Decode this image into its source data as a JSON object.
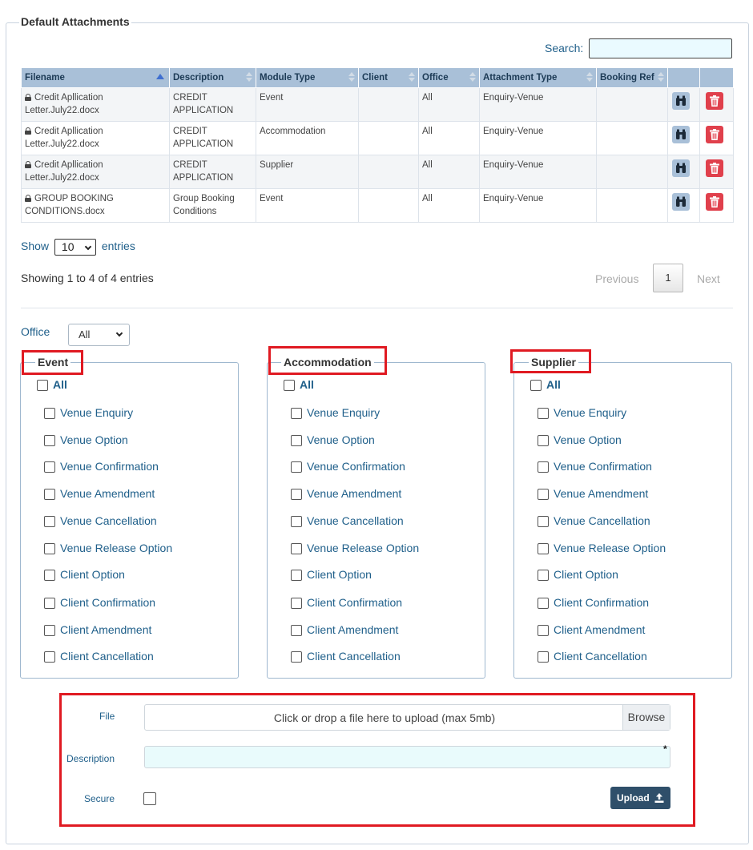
{
  "panel": {
    "title": "Default Attachments"
  },
  "search": {
    "label": "Search:",
    "value": ""
  },
  "table": {
    "columns": [
      "Filename",
      "Description",
      "Module Type",
      "Client",
      "Office",
      "Attachment Type",
      "Booking Ref"
    ],
    "rows": [
      {
        "filename_1": "Credit Apllication",
        "filename_2": "Letter.July22.docx",
        "description_1": "CREDIT",
        "description_2": "APPLICATION",
        "module": "Event",
        "client": "",
        "office": "All",
        "attachment_type": "Enquiry-Venue",
        "booking_ref": ""
      },
      {
        "filename_1": "Credit Apllication",
        "filename_2": "Letter.July22.docx",
        "description_1": "CREDIT",
        "description_2": "APPLICATION",
        "module": "Accommodation",
        "client": "",
        "office": "All",
        "attachment_type": "Enquiry-Venue",
        "booking_ref": ""
      },
      {
        "filename_1": "Credit Apllication",
        "filename_2": "Letter.July22.docx",
        "description_1": "CREDIT",
        "description_2": "APPLICATION",
        "module": "Supplier",
        "client": "",
        "office": "All",
        "attachment_type": "Enquiry-Venue",
        "booking_ref": ""
      },
      {
        "filename_1": "GROUP BOOKING",
        "filename_2": "CONDITIONS.docx",
        "description_1": "Group Booking",
        "description_2": "Conditions",
        "module": "Event",
        "client": "",
        "office": "All",
        "attachment_type": "Enquiry-Venue",
        "booking_ref": ""
      }
    ]
  },
  "length": {
    "show": "Show",
    "value": "10",
    "entries": "entries"
  },
  "info": "Showing 1 to 4 of 4 entries",
  "pager": {
    "previous": "Previous",
    "page": "1",
    "next": "Next"
  },
  "office": {
    "label": "Office",
    "value": "All"
  },
  "groups": [
    {
      "title": "Event"
    },
    {
      "title": "Accommodation"
    },
    {
      "title": "Supplier"
    }
  ],
  "all_label": "All",
  "options": [
    "Venue Enquiry",
    "Venue Option",
    "Venue Confirmation",
    "Venue Amendment",
    "Venue Cancellation",
    "Venue Release Option",
    "Client Option",
    "Client Confirmation",
    "Client Amendment",
    "Client Cancellation"
  ],
  "upload": {
    "file_label": "File",
    "file_placeholder": "Click or drop a file here to upload (max 5mb)",
    "browse": "Browse",
    "description_label": "Description",
    "required_mark": "*",
    "secure_label": "Secure",
    "upload_button": "Upload"
  },
  "colors": {
    "header_bg": "#a9c0d8",
    "highlight": "#e01a22",
    "link": "#1f5f8a",
    "delete": "#e0404c",
    "upload_btn": "#2f4f6a"
  }
}
